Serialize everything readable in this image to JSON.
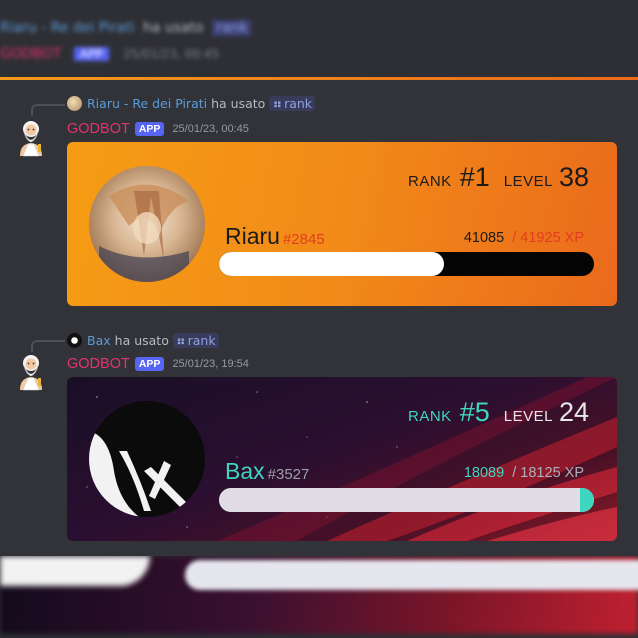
{
  "blurred_header": {
    "reply_user": "Riaru - Re dei Pirati",
    "reply_used": "ha usato",
    "reply_command": "rank",
    "bot_name": "GODBOT",
    "badge": "APP",
    "timestamp": "25/01/23, 00:45"
  },
  "messages": [
    {
      "reply_user": "Riaru - Re dei Pirati",
      "reply_used": "ha usato",
      "reply_command": "rank",
      "bot_name": "GODBOT",
      "badge": "APP",
      "timestamp": "25/01/23, 00:45",
      "card": {
        "theme": "orange",
        "rank_label": "RANK",
        "rank_value": "#1",
        "level_label": "LEVEL",
        "level_value": "38",
        "username": "Riaru",
        "discriminator": "#2845",
        "xp_current": "41085",
        "xp_total": "/ 41925 XP",
        "progress": 0.6,
        "colors": {
          "accent": "#e23d20",
          "bar_fill": "#ffffff",
          "bar_track": "#050505"
        }
      }
    },
    {
      "reply_user": "Bax",
      "reply_used": "ha usato",
      "reply_command": "rank",
      "bot_name": "GODBOT",
      "badge": "APP",
      "timestamp": "25/01/23, 19:54",
      "card": {
        "theme": "dark",
        "rank_label": "RANK",
        "rank_value": "#5",
        "level_label": "LEVEL",
        "level_value": "24",
        "username": "Bax",
        "discriminator": "#3527",
        "xp_current": "18089",
        "xp_total": "/ 18125 XP",
        "progress": 0.99,
        "colors": {
          "accent": "#3fd6c0",
          "bar_fill": "#e0dde6",
          "bar_track": "#e0dde6"
        }
      }
    }
  ],
  "icons": {
    "reply_spine": "reply-connector",
    "command": "slash-command-icon",
    "bot_avatar": "zeus-avatar-icon"
  },
  "colors": {
    "background": "#313338",
    "bot_name": "#e6336b",
    "app_badge": "#5865f2",
    "link": "#5a9bd8",
    "divider": "#f39a1a"
  }
}
